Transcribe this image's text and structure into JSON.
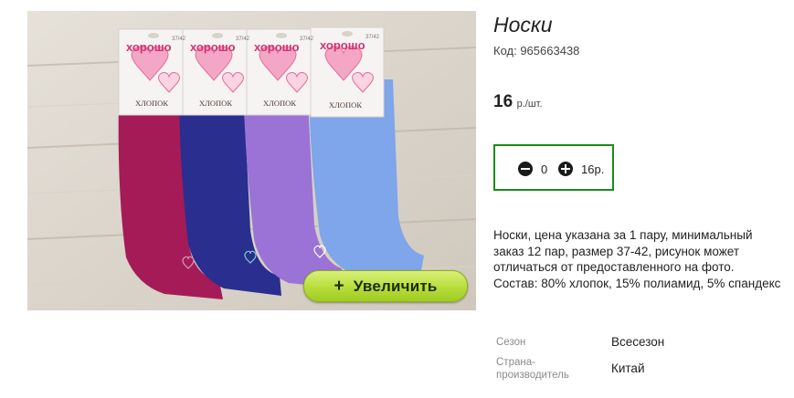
{
  "product": {
    "title": "Носки",
    "code": "Код: 965663438",
    "price_value": "16",
    "price_unit": "р./шт.",
    "zoom_button": {
      "icon": "plus-icon",
      "label": "Увеличить"
    },
    "quantity": {
      "value": "0",
      "sum": "16р."
    },
    "description": "Носки, цена указана за 1 пару, минимальный заказ 12 пар, размер 37-42, рисунок может отличаться от предоставленного на фото. Состав: 80% хлопок, 15% полиамид, 5% спандекс",
    "attributes": [
      {
        "label": "Сезон",
        "value": "Всесезон"
      },
      {
        "label": "Страна-производитель",
        "value": "Китай"
      }
    ]
  },
  "photo_labels": {
    "brand": "хорошо",
    "material": "ХЛОПОК",
    "sizes": [
      "37/42",
      "37/42",
      "37/42",
      "37/42"
    ]
  },
  "colors": {
    "qty_border": "#1a8c1a",
    "zoom_button": "#b7dd3a",
    "sock_colors": [
      "#a51b57",
      "#2a2e8e",
      "#9b72d6",
      "#7fa5ea"
    ]
  }
}
